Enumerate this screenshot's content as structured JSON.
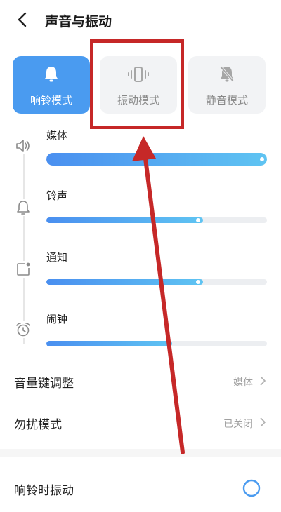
{
  "header": {
    "title": "声音与振动"
  },
  "modes": [
    {
      "label": "响铃模式",
      "icon": "bell-icon",
      "active": true
    },
    {
      "label": "振动模式",
      "icon": "vibrate-icon",
      "active": false
    },
    {
      "label": "静音模式",
      "icon": "bell-off-icon",
      "active": false
    }
  ],
  "volume": [
    {
      "label": "媒体",
      "icon": "speaker-icon",
      "level": 1.0
    },
    {
      "label": "铃声",
      "icon": "bell-outline-icon",
      "level": 0.71
    },
    {
      "label": "通知",
      "icon": "notification-icon",
      "level": 0.71
    },
    {
      "label": "闹钟",
      "icon": "alarm-clock-icon",
      "level": 0.57
    }
  ],
  "settings": {
    "volume_key": {
      "label": "音量键调整",
      "value": "媒体"
    },
    "dnd": {
      "label": "勿扰模式",
      "value": "已关闭"
    },
    "vibrate_on_ring": {
      "label": "响铃时振动"
    }
  },
  "colors": {
    "accent": "#4a9bf0",
    "annotation": "#c62828"
  }
}
